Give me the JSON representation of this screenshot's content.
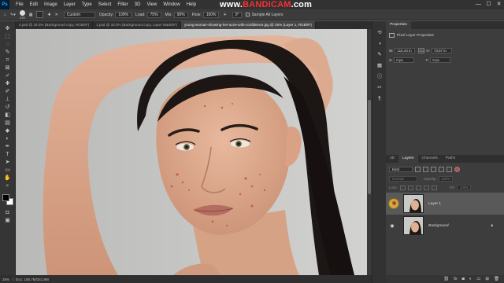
{
  "app": {
    "logo": "Ps"
  },
  "menu": [
    "File",
    "Edit",
    "Image",
    "Layer",
    "Type",
    "Select",
    "Filter",
    "3D",
    "View",
    "Window",
    "Help"
  ],
  "watermark": {
    "prefix": "www.",
    "brand": "BANDICAM",
    "suffix": ".com"
  },
  "window_controls": [
    "—",
    "☐",
    "✕"
  ],
  "options_bar": {
    "brush_size": "175",
    "mode_label": "Mode:",
    "mode_value": "Custom",
    "opacity_label": "Opacity:",
    "opacity_value": "100%",
    "flow_label": "Flow:",
    "flow_value": "90%",
    "load_label": "Load:",
    "load_value": "75%",
    "mix_label": "Mix:",
    "mix_value": "100%",
    "flow2_label": "Flow:",
    "flow2_value": "100%",
    "angle_value": "0°",
    "sample_label": "Sample All Layers"
  },
  "tabs": [
    {
      "label": "4.psd @ 33.3% (Background copy, RGB/8*)"
    },
    {
      "label": "1.psd @ 33.3% (Background copy, Layer Mask/8*)"
    },
    {
      "label": "young-woman-showing-her-acne-with-confidence.jpg @ 25% (Layer 1, RGB/8*)",
      "active": true
    }
  ],
  "toolbar_icons": [
    "move-icon",
    "marquee-icon",
    "lasso-icon",
    "quick-select-icon",
    "crop-icon",
    "frame-icon",
    "eyedropper-icon",
    "healing-icon",
    "brush-icon",
    "stamp-icon",
    "history-brush-icon",
    "eraser-icon",
    "gradient-icon",
    "blur-icon",
    "dodge-icon",
    "pen-icon",
    "type-icon",
    "path-select-icon",
    "rectangle-icon",
    "hand-icon",
    "zoom-icon",
    "more-icon"
  ],
  "status": {
    "zoom": "25%",
    "doc": "Doc: 106,7M/241,9M"
  },
  "properties": {
    "tab_label": "Properties",
    "title": "Pixel Layer Properties",
    "w_label": "W:",
    "w_value": "110,44 in",
    "go_label": "GO",
    "h_label": "H:",
    "h_value": "73,67 in",
    "x_label": "X:",
    "x_value": "0 px",
    "y_label": "Y:",
    "y_value": "0 px"
  },
  "layers_panel": {
    "tabs": [
      {
        "label": "3D"
      },
      {
        "label": "Layers",
        "active": true
      },
      {
        "label": "Channels"
      },
      {
        "label": "Paths"
      }
    ],
    "kind_label": "Kind",
    "blend_mode": "Normal",
    "opacity_label": "Opacity:",
    "opacity_value": "100%",
    "lock_label": "Lock:",
    "fill_label": "Fill:",
    "fill_value": "100%",
    "layers": [
      {
        "name": "Layer 1",
        "selected": true,
        "italic": false
      },
      {
        "name": "Background",
        "selected": false,
        "italic": true
      }
    ]
  }
}
